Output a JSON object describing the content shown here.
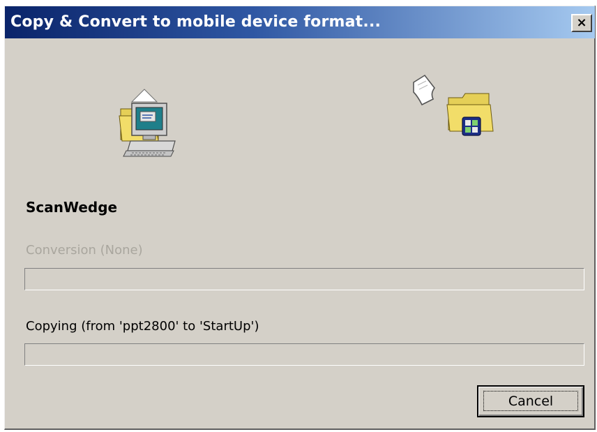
{
  "window": {
    "title": "Copy & Convert to mobile device format...",
    "close_glyph": "×"
  },
  "icons": {
    "source": "computer-folder-icon",
    "transfer": "flying-document-icon",
    "destination": "mobile-device-folder-icon"
  },
  "file_name": "ScanWedge",
  "conversion": {
    "label": "Conversion (None)",
    "progress": 0
  },
  "copying": {
    "label": "Copying (from 'ppt2800' to 'StartUp')",
    "progress": 0
  },
  "buttons": {
    "cancel_label": "Cancel"
  },
  "colors": {
    "title_gradient_start": "#0a246a",
    "title_gradient_end": "#a6caf0",
    "dialog_face": "#d4d0c8",
    "disabled_text": "#a9a69e"
  }
}
